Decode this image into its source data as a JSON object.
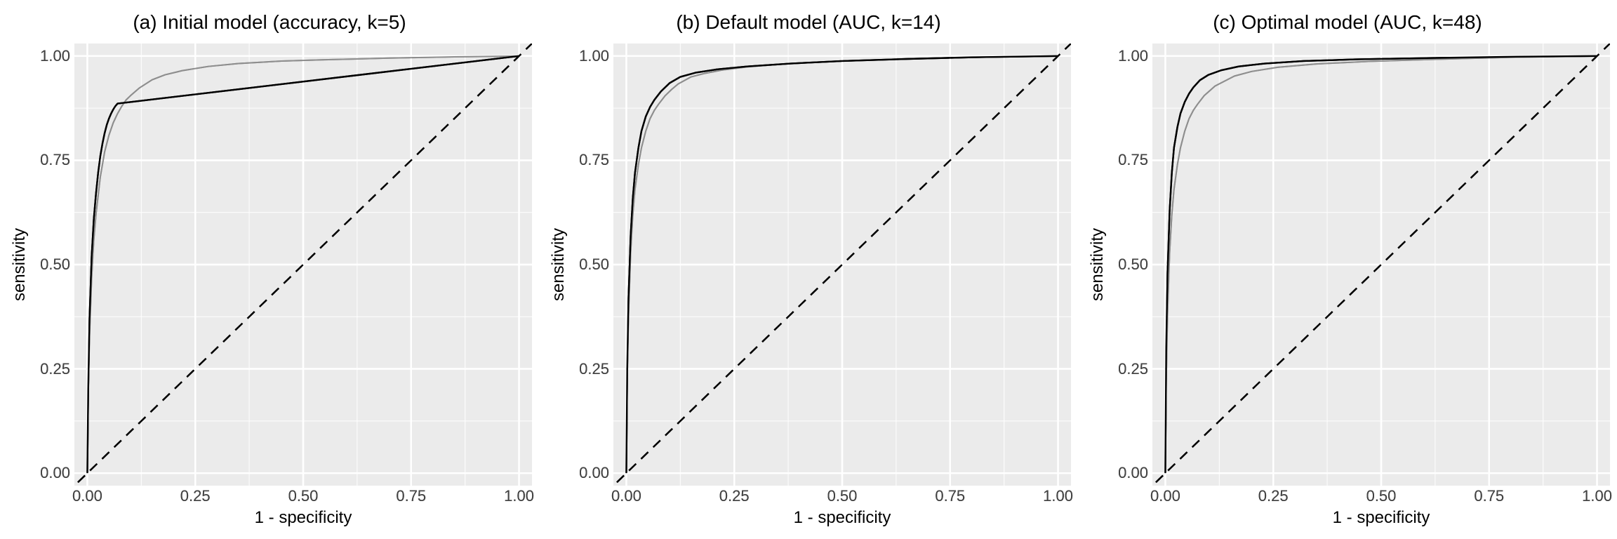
{
  "chart_data": [
    {
      "type": "line",
      "title": "(a) Initial model (accuracy, k=5)",
      "xlabel": "1 - specificity",
      "ylabel": "sensitivity",
      "xlim": [
        0,
        1
      ],
      "ylim": [
        0,
        1
      ],
      "ticks": {
        "x": [
          0.0,
          0.25,
          0.5,
          0.75,
          1.0
        ],
        "y": [
          0.0,
          0.25,
          0.5,
          0.75,
          1.0
        ]
      },
      "tick_labels": {
        "x": [
          "0.00",
          "0.25",
          "0.50",
          "0.75",
          "1.00"
        ],
        "y": [
          "0.00",
          "0.25",
          "0.50",
          "0.75",
          "1.00"
        ]
      },
      "reference": [
        [
          0,
          0
        ],
        [
          1,
          1
        ]
      ],
      "series": [
        {
          "name": "gray",
          "color": "#8E8E8E",
          "values": [
            [
              0.0,
              0.0
            ],
            [
              0.002,
              0.18
            ],
            [
              0.005,
              0.33
            ],
            [
              0.01,
              0.47
            ],
            [
              0.015,
              0.56
            ],
            [
              0.02,
              0.62
            ],
            [
              0.03,
              0.71
            ],
            [
              0.04,
              0.77
            ],
            [
              0.05,
              0.81
            ],
            [
              0.06,
              0.84
            ],
            [
              0.07,
              0.862
            ],
            [
              0.08,
              0.88
            ],
            [
              0.09,
              0.895
            ],
            [
              0.1,
              0.905
            ],
            [
              0.12,
              0.923
            ],
            [
              0.15,
              0.943
            ],
            [
              0.18,
              0.955
            ],
            [
              0.22,
              0.965
            ],
            [
              0.28,
              0.975
            ],
            [
              0.35,
              0.982
            ],
            [
              0.45,
              0.988
            ],
            [
              0.55,
              0.991
            ],
            [
              0.7,
              0.995
            ],
            [
              0.85,
              0.998
            ],
            [
              1.0,
              1.0
            ]
          ]
        },
        {
          "name": "black",
          "color": "#000000",
          "values": [
            [
              0.0,
              0.0
            ],
            [
              0.002,
              0.2
            ],
            [
              0.005,
              0.37
            ],
            [
              0.01,
              0.52
            ],
            [
              0.015,
              0.61
            ],
            [
              0.02,
              0.67
            ],
            [
              0.025,
              0.72
            ],
            [
              0.03,
              0.76
            ],
            [
              0.035,
              0.79
            ],
            [
              0.04,
              0.815
            ],
            [
              0.045,
              0.835
            ],
            [
              0.05,
              0.85
            ],
            [
              0.055,
              0.862
            ],
            [
              0.06,
              0.872
            ],
            [
              0.065,
              0.88
            ],
            [
              0.07,
              0.886
            ],
            [
              1.0,
              1.0
            ]
          ]
        }
      ]
    },
    {
      "type": "line",
      "title": "(b) Default model (AUC, k=14)",
      "xlabel": "1 - specificity",
      "ylabel": "sensitivity",
      "xlim": [
        0,
        1
      ],
      "ylim": [
        0,
        1
      ],
      "ticks": {
        "x": [
          0.0,
          0.25,
          0.5,
          0.75,
          1.0
        ],
        "y": [
          0.0,
          0.25,
          0.5,
          0.75,
          1.0
        ]
      },
      "tick_labels": {
        "x": [
          "0.00",
          "0.25",
          "0.50",
          "0.75",
          "1.00"
        ],
        "y": [
          "0.00",
          "0.25",
          "0.50",
          "0.75",
          "1.00"
        ]
      },
      "reference": [
        [
          0,
          0
        ],
        [
          1,
          1
        ]
      ],
      "series": [
        {
          "name": "gray",
          "color": "#8E8E8E",
          "values": [
            [
              0.0,
              0.0
            ],
            [
              0.002,
              0.22
            ],
            [
              0.005,
              0.38
            ],
            [
              0.01,
              0.53
            ],
            [
              0.015,
              0.62
            ],
            [
              0.02,
              0.68
            ],
            [
              0.028,
              0.74
            ],
            [
              0.035,
              0.78
            ],
            [
              0.045,
              0.82
            ],
            [
              0.055,
              0.85
            ],
            [
              0.065,
              0.87
            ],
            [
              0.075,
              0.885
            ],
            [
              0.09,
              0.905
            ],
            [
              0.105,
              0.92
            ],
            [
              0.12,
              0.933
            ],
            [
              0.15,
              0.95
            ],
            [
              0.18,
              0.958
            ],
            [
              0.22,
              0.966
            ],
            [
              0.28,
              0.974
            ],
            [
              0.38,
              0.982
            ],
            [
              0.5,
              0.988
            ],
            [
              0.65,
              0.993
            ],
            [
              0.8,
              0.997
            ],
            [
              1.0,
              1.0
            ]
          ]
        },
        {
          "name": "black",
          "color": "#000000",
          "values": [
            [
              0.0,
              0.0
            ],
            [
              0.002,
              0.25
            ],
            [
              0.005,
              0.42
            ],
            [
              0.01,
              0.57
            ],
            [
              0.015,
              0.66
            ],
            [
              0.02,
              0.72
            ],
            [
              0.028,
              0.78
            ],
            [
              0.035,
              0.82
            ],
            [
              0.045,
              0.855
            ],
            [
              0.055,
              0.878
            ],
            [
              0.065,
              0.895
            ],
            [
              0.08,
              0.915
            ],
            [
              0.1,
              0.935
            ],
            [
              0.125,
              0.95
            ],
            [
              0.16,
              0.96
            ],
            [
              0.21,
              0.968
            ],
            [
              0.28,
              0.975
            ],
            [
              0.38,
              0.982
            ],
            [
              0.5,
              0.988
            ],
            [
              0.65,
              0.993
            ],
            [
              0.8,
              0.997
            ],
            [
              1.0,
              1.0
            ]
          ]
        }
      ]
    },
    {
      "type": "line",
      "title": "(c) Optimal model (AUC, k=48)",
      "xlabel": "1 - specificity",
      "ylabel": "sensitivity",
      "xlim": [
        0,
        1
      ],
      "ylim": [
        0,
        1
      ],
      "ticks": {
        "x": [
          0.0,
          0.25,
          0.5,
          0.75,
          1.0
        ],
        "y": [
          0.0,
          0.25,
          0.5,
          0.75,
          1.0
        ]
      },
      "tick_labels": {
        "x": [
          "0.00",
          "0.25",
          "0.50",
          "0.75",
          "1.00"
        ],
        "y": [
          "0.00",
          "0.25",
          "0.50",
          "0.75",
          "1.00"
        ]
      },
      "reference": [
        [
          0,
          0
        ],
        [
          1,
          1
        ]
      ],
      "series": [
        {
          "name": "gray",
          "color": "#8E8E8E",
          "values": [
            [
              0.0,
              0.0
            ],
            [
              0.002,
              0.22
            ],
            [
              0.005,
              0.38
            ],
            [
              0.01,
              0.53
            ],
            [
              0.015,
              0.62
            ],
            [
              0.02,
              0.68
            ],
            [
              0.028,
              0.74
            ],
            [
              0.035,
              0.78
            ],
            [
              0.045,
              0.82
            ],
            [
              0.055,
              0.85
            ],
            [
              0.065,
              0.87
            ],
            [
              0.075,
              0.885
            ],
            [
              0.09,
              0.905
            ],
            [
              0.115,
              0.928
            ],
            [
              0.16,
              0.952
            ],
            [
              0.2,
              0.963
            ],
            [
              0.26,
              0.973
            ],
            [
              0.35,
              0.981
            ],
            [
              0.47,
              0.987
            ],
            [
              0.62,
              0.992
            ],
            [
              0.8,
              0.997
            ],
            [
              1.0,
              1.0
            ]
          ]
        },
        {
          "name": "black",
          "color": "#000000",
          "values": [
            [
              0.0,
              0.0
            ],
            [
              0.002,
              0.3
            ],
            [
              0.005,
              0.48
            ],
            [
              0.01,
              0.63
            ],
            [
              0.015,
              0.72
            ],
            [
              0.02,
              0.78
            ],
            [
              0.028,
              0.83
            ],
            [
              0.035,
              0.862
            ],
            [
              0.045,
              0.89
            ],
            [
              0.055,
              0.91
            ],
            [
              0.065,
              0.925
            ],
            [
              0.08,
              0.942
            ],
            [
              0.1,
              0.955
            ],
            [
              0.13,
              0.966
            ],
            [
              0.17,
              0.975
            ],
            [
              0.23,
              0.982
            ],
            [
              0.32,
              0.988
            ],
            [
              0.44,
              0.992
            ],
            [
              0.6,
              0.995
            ],
            [
              0.78,
              0.998
            ],
            [
              1.0,
              1.0
            ]
          ]
        }
      ]
    }
  ]
}
